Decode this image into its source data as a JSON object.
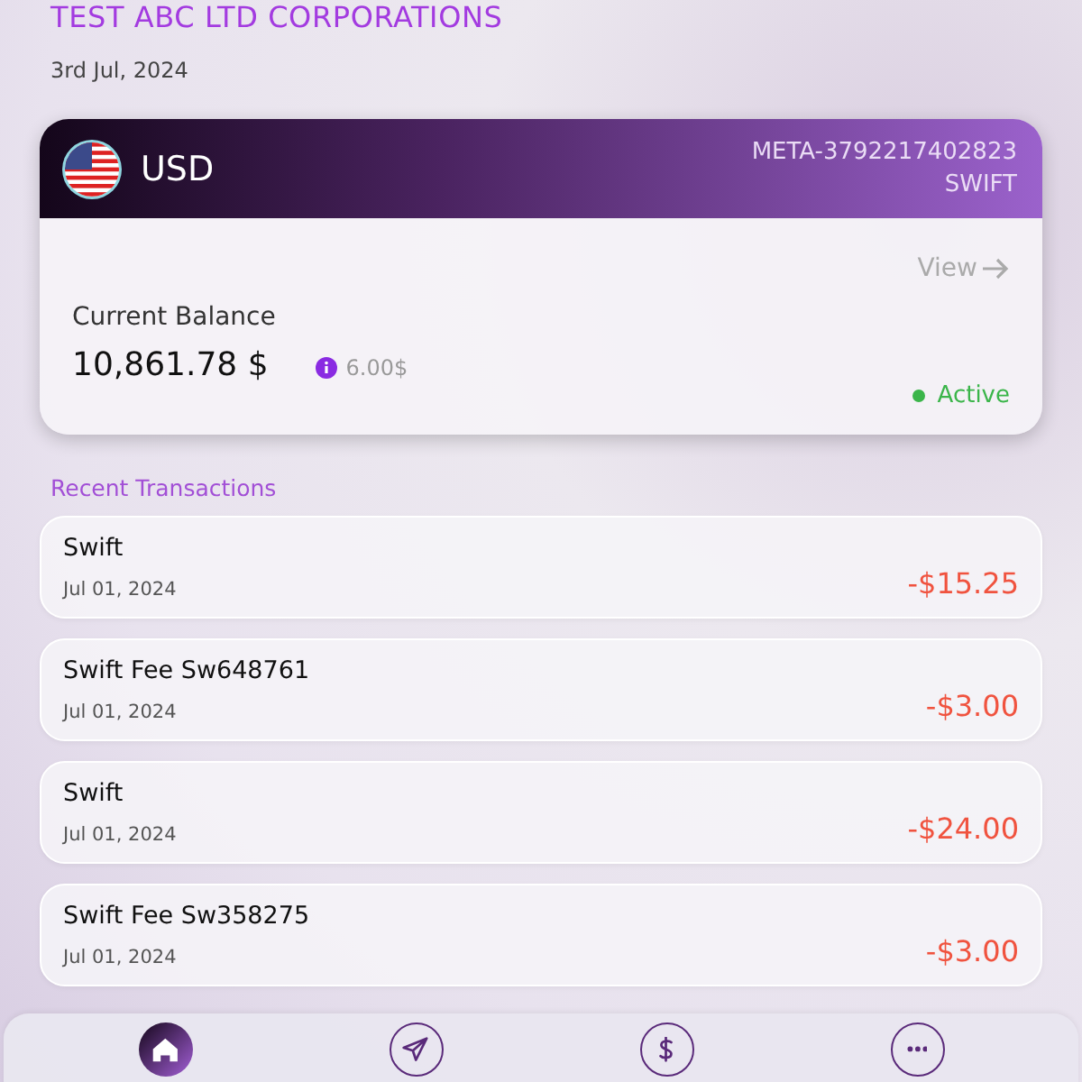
{
  "company": "TEST ABC LTD CORPORATIONS",
  "date": "3rd Jul, 2024",
  "account": {
    "currency": "USD",
    "account_id": "META-3792217402823",
    "network": "SWIFT",
    "view_link": "View",
    "balance_label": "Current Balance",
    "balance": "10,861.78 $",
    "fee": "6.00$",
    "status": "Active",
    "active": true
  },
  "section_title": "Recent Transactions",
  "transactions": [
    {
      "title": "Swift",
      "date": "Jul 01, 2024",
      "amount": "-$15.25"
    },
    {
      "title": "Swift Fee Sw648761",
      "date": "Jul 01, 2024",
      "amount": "-$3.00"
    },
    {
      "title": "Swift",
      "date": "Jul 01, 2024",
      "amount": "-$24.00"
    },
    {
      "title": "Swift Fee Sw358275",
      "date": "Jul 01, 2024",
      "amount": "-$3.00"
    }
  ],
  "nav": [
    {
      "kind": "home",
      "selected": true
    },
    {
      "kind": "send",
      "selected": false
    },
    {
      "kind": "dollar",
      "selected": false
    },
    {
      "kind": "more",
      "selected": false
    }
  ]
}
